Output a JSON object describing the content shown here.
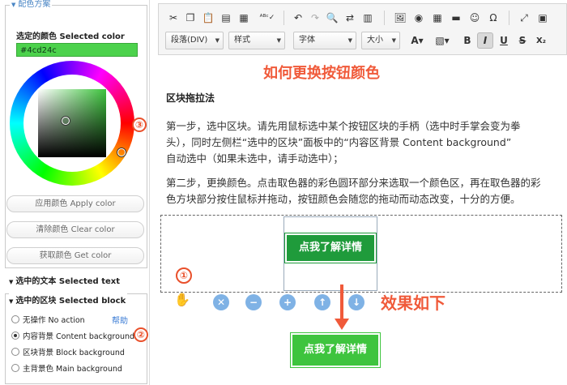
{
  "left_panel": {
    "color_scheme_legend": "配色方案",
    "selected_color_label": "选定的颜色 Selected color",
    "selected_color_value": "#4cd24c",
    "callout_3": "③",
    "buttons": {
      "apply": "应用颜色 Apply color",
      "clear": "清除颜色 Clear color",
      "get": "获取颜色 Get color"
    },
    "selected_text_title": "选中的文本 Selected text",
    "selected_block_title": "选中的区块 Selected block",
    "options": [
      {
        "label": "无操作 No action",
        "checked": false
      },
      {
        "label": "内容背景 Content background",
        "checked": true
      },
      {
        "label": "区块背景 Block background",
        "checked": false
      },
      {
        "label": "主背景色 Main background",
        "checked": false
      }
    ],
    "help": "帮助",
    "callout_2": "②"
  },
  "toolbar": {
    "row1_icons": [
      "cut-icon",
      "copy-icon",
      "paste-icon",
      "paste-text-icon",
      "paste-word-icon",
      "spellcheck-icon",
      "undo-icon",
      "redo-icon",
      "find-icon",
      "replace-icon",
      "select-all-icon",
      "image-icon",
      "flash-icon",
      "table-icon",
      "horizontal-line-icon",
      "smiley-icon",
      "special-char-icon",
      "maximize-icon",
      "show-blocks-icon"
    ],
    "paragraph_format": "段落(DIV)",
    "styles": "样式",
    "font": "字体",
    "size": "大小",
    "format_buttons": [
      "B",
      "I",
      "U",
      "S",
      "X₂"
    ]
  },
  "document": {
    "title": "如何更换按钮颜色",
    "section_heading": "区块拖拉法",
    "step1": [
      "第一步，选中区块。请先用鼠标选中某个按钮区块的手柄（选中时手掌会变为拳",
      "头），同时左侧栏“选中的区块”面板中的“内容区背景 Content background”",
      "自动选中（如果未选中，请手动选中）；"
    ],
    "step2": [
      "第二步，更换颜色。点击取色器的彩色圆环部分来选取一个颜色区，再在取色器的彩",
      "色方块部分按住鼠标并拖动，按钮颜色会随您的拖动而动态改变，十分的方便。"
    ],
    "button_text": "点我了解详情",
    "result_button_text": "点我了解详情",
    "callout_1": "①",
    "effect_label": "效果如下",
    "block_handles": [
      "close-icon",
      "minus-icon",
      "plus-icon",
      "up-icon",
      "down-icon"
    ]
  },
  "colors": {
    "accent_red": "#f05a3a",
    "button_green_before": "#1f9b3b",
    "button_green_after": "#3ec43e",
    "legend_blue": "#4a86c5"
  }
}
